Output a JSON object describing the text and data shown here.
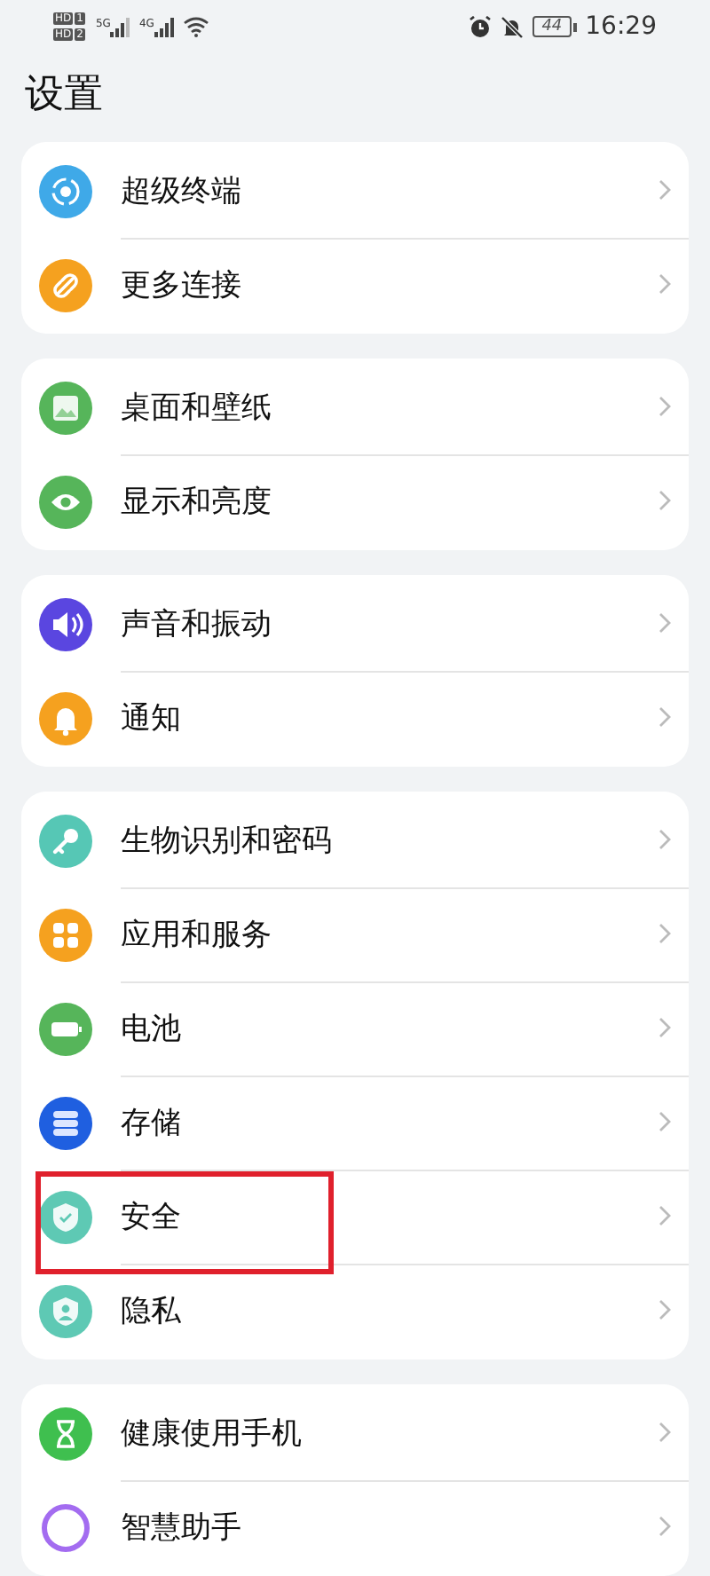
{
  "status_bar": {
    "sims": [
      {
        "badge": "HD",
        "slot": "1"
      },
      {
        "badge": "HD",
        "slot": "2"
      }
    ],
    "networks": [
      "5G",
      "4G"
    ],
    "battery": "44",
    "time": "16:29"
  },
  "title": "设置",
  "groups": [
    {
      "items": [
        {
          "label": "超级终端",
          "color": "#3fa9e8",
          "highlighted": false
        },
        {
          "label": "更多连接",
          "color": "#f5a11f",
          "highlighted": false
        }
      ]
    },
    {
      "items": [
        {
          "label": "桌面和壁纸",
          "color": "#56b55a",
          "highlighted": false
        },
        {
          "label": "显示和亮度",
          "color": "#56b55a",
          "highlighted": false
        }
      ]
    },
    {
      "items": [
        {
          "label": "声音和振动",
          "color": "#5a46e0",
          "highlighted": false
        },
        {
          "label": "通知",
          "color": "#f5a11f",
          "highlighted": false
        }
      ]
    },
    {
      "items": [
        {
          "label": "生物识别和密码",
          "color": "#56c7b5",
          "highlighted": false
        },
        {
          "label": "应用和服务",
          "color": "#f5a11f",
          "highlighted": false
        },
        {
          "label": "电池",
          "color": "#56b55a",
          "highlighted": false
        },
        {
          "label": "存储",
          "color": "#1f5fe0",
          "highlighted": false
        },
        {
          "label": "安全",
          "color": "#5ec9b4",
          "highlighted": true
        },
        {
          "label": "隐私",
          "color": "#5ec9b4",
          "highlighted": false
        }
      ]
    },
    {
      "items": [
        {
          "label": "健康使用手机",
          "color": "#3fbf4f",
          "highlighted": false
        },
        {
          "label": "智慧助手",
          "color": "#a36cf0",
          "highlighted": false
        }
      ]
    }
  ]
}
